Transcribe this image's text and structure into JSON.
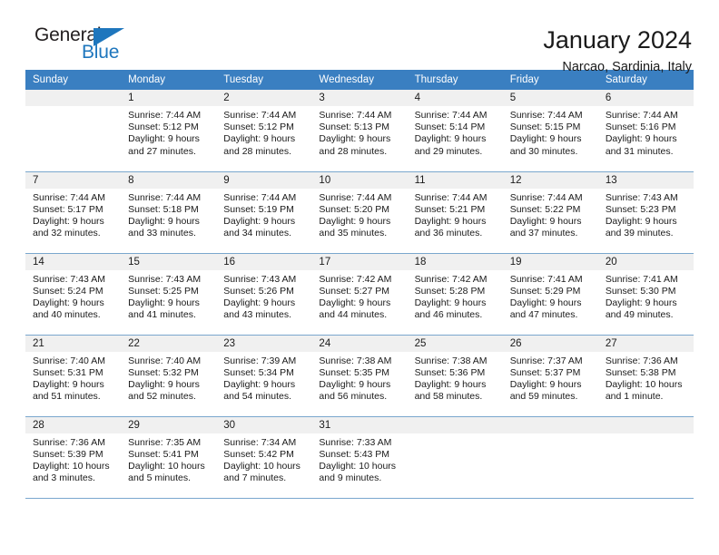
{
  "brand": {
    "name_top": "General",
    "name_bottom": "Blue",
    "accent_color": "#1e76bd"
  },
  "header": {
    "title": "January 2024",
    "subtitle": "Narcao, Sardinia, Italy"
  },
  "colors": {
    "header_bar": "#3a7fc1",
    "daynum_band": "#f0f0f0",
    "row_divider": "#7aa7ce",
    "text": "#1a1a1a"
  },
  "weekdays": [
    "Sunday",
    "Monday",
    "Tuesday",
    "Wednesday",
    "Thursday",
    "Friday",
    "Saturday"
  ],
  "weeks": [
    [
      {
        "day": "",
        "sunrise": "",
        "sunset": "",
        "daylight_line1": "",
        "daylight_line2": ""
      },
      {
        "day": "1",
        "sunrise": "Sunrise: 7:44 AM",
        "sunset": "Sunset: 5:12 PM",
        "daylight_line1": "Daylight: 9 hours",
        "daylight_line2": "and 27 minutes."
      },
      {
        "day": "2",
        "sunrise": "Sunrise: 7:44 AM",
        "sunset": "Sunset: 5:12 PM",
        "daylight_line1": "Daylight: 9 hours",
        "daylight_line2": "and 28 minutes."
      },
      {
        "day": "3",
        "sunrise": "Sunrise: 7:44 AM",
        "sunset": "Sunset: 5:13 PM",
        "daylight_line1": "Daylight: 9 hours",
        "daylight_line2": "and 28 minutes."
      },
      {
        "day": "4",
        "sunrise": "Sunrise: 7:44 AM",
        "sunset": "Sunset: 5:14 PM",
        "daylight_line1": "Daylight: 9 hours",
        "daylight_line2": "and 29 minutes."
      },
      {
        "day": "5",
        "sunrise": "Sunrise: 7:44 AM",
        "sunset": "Sunset: 5:15 PM",
        "daylight_line1": "Daylight: 9 hours",
        "daylight_line2": "and 30 minutes."
      },
      {
        "day": "6",
        "sunrise": "Sunrise: 7:44 AM",
        "sunset": "Sunset: 5:16 PM",
        "daylight_line1": "Daylight: 9 hours",
        "daylight_line2": "and 31 minutes."
      }
    ],
    [
      {
        "day": "7",
        "sunrise": "Sunrise: 7:44 AM",
        "sunset": "Sunset: 5:17 PM",
        "daylight_line1": "Daylight: 9 hours",
        "daylight_line2": "and 32 minutes."
      },
      {
        "day": "8",
        "sunrise": "Sunrise: 7:44 AM",
        "sunset": "Sunset: 5:18 PM",
        "daylight_line1": "Daylight: 9 hours",
        "daylight_line2": "and 33 minutes."
      },
      {
        "day": "9",
        "sunrise": "Sunrise: 7:44 AM",
        "sunset": "Sunset: 5:19 PM",
        "daylight_line1": "Daylight: 9 hours",
        "daylight_line2": "and 34 minutes."
      },
      {
        "day": "10",
        "sunrise": "Sunrise: 7:44 AM",
        "sunset": "Sunset: 5:20 PM",
        "daylight_line1": "Daylight: 9 hours",
        "daylight_line2": "and 35 minutes."
      },
      {
        "day": "11",
        "sunrise": "Sunrise: 7:44 AM",
        "sunset": "Sunset: 5:21 PM",
        "daylight_line1": "Daylight: 9 hours",
        "daylight_line2": "and 36 minutes."
      },
      {
        "day": "12",
        "sunrise": "Sunrise: 7:44 AM",
        "sunset": "Sunset: 5:22 PM",
        "daylight_line1": "Daylight: 9 hours",
        "daylight_line2": "and 37 minutes."
      },
      {
        "day": "13",
        "sunrise": "Sunrise: 7:43 AM",
        "sunset": "Sunset: 5:23 PM",
        "daylight_line1": "Daylight: 9 hours",
        "daylight_line2": "and 39 minutes."
      }
    ],
    [
      {
        "day": "14",
        "sunrise": "Sunrise: 7:43 AM",
        "sunset": "Sunset: 5:24 PM",
        "daylight_line1": "Daylight: 9 hours",
        "daylight_line2": "and 40 minutes."
      },
      {
        "day": "15",
        "sunrise": "Sunrise: 7:43 AM",
        "sunset": "Sunset: 5:25 PM",
        "daylight_line1": "Daylight: 9 hours",
        "daylight_line2": "and 41 minutes."
      },
      {
        "day": "16",
        "sunrise": "Sunrise: 7:43 AM",
        "sunset": "Sunset: 5:26 PM",
        "daylight_line1": "Daylight: 9 hours",
        "daylight_line2": "and 43 minutes."
      },
      {
        "day": "17",
        "sunrise": "Sunrise: 7:42 AM",
        "sunset": "Sunset: 5:27 PM",
        "daylight_line1": "Daylight: 9 hours",
        "daylight_line2": "and 44 minutes."
      },
      {
        "day": "18",
        "sunrise": "Sunrise: 7:42 AM",
        "sunset": "Sunset: 5:28 PM",
        "daylight_line1": "Daylight: 9 hours",
        "daylight_line2": "and 46 minutes."
      },
      {
        "day": "19",
        "sunrise": "Sunrise: 7:41 AM",
        "sunset": "Sunset: 5:29 PM",
        "daylight_line1": "Daylight: 9 hours",
        "daylight_line2": "and 47 minutes."
      },
      {
        "day": "20",
        "sunrise": "Sunrise: 7:41 AM",
        "sunset": "Sunset: 5:30 PM",
        "daylight_line1": "Daylight: 9 hours",
        "daylight_line2": "and 49 minutes."
      }
    ],
    [
      {
        "day": "21",
        "sunrise": "Sunrise: 7:40 AM",
        "sunset": "Sunset: 5:31 PM",
        "daylight_line1": "Daylight: 9 hours",
        "daylight_line2": "and 51 minutes."
      },
      {
        "day": "22",
        "sunrise": "Sunrise: 7:40 AM",
        "sunset": "Sunset: 5:32 PM",
        "daylight_line1": "Daylight: 9 hours",
        "daylight_line2": "and 52 minutes."
      },
      {
        "day": "23",
        "sunrise": "Sunrise: 7:39 AM",
        "sunset": "Sunset: 5:34 PM",
        "daylight_line1": "Daylight: 9 hours",
        "daylight_line2": "and 54 minutes."
      },
      {
        "day": "24",
        "sunrise": "Sunrise: 7:38 AM",
        "sunset": "Sunset: 5:35 PM",
        "daylight_line1": "Daylight: 9 hours",
        "daylight_line2": "and 56 minutes."
      },
      {
        "day": "25",
        "sunrise": "Sunrise: 7:38 AM",
        "sunset": "Sunset: 5:36 PM",
        "daylight_line1": "Daylight: 9 hours",
        "daylight_line2": "and 58 minutes."
      },
      {
        "day": "26",
        "sunrise": "Sunrise: 7:37 AM",
        "sunset": "Sunset: 5:37 PM",
        "daylight_line1": "Daylight: 9 hours",
        "daylight_line2": "and 59 minutes."
      },
      {
        "day": "27",
        "sunrise": "Sunrise: 7:36 AM",
        "sunset": "Sunset: 5:38 PM",
        "daylight_line1": "Daylight: 10 hours",
        "daylight_line2": "and 1 minute."
      }
    ],
    [
      {
        "day": "28",
        "sunrise": "Sunrise: 7:36 AM",
        "sunset": "Sunset: 5:39 PM",
        "daylight_line1": "Daylight: 10 hours",
        "daylight_line2": "and 3 minutes."
      },
      {
        "day": "29",
        "sunrise": "Sunrise: 7:35 AM",
        "sunset": "Sunset: 5:41 PM",
        "daylight_line1": "Daylight: 10 hours",
        "daylight_line2": "and 5 minutes."
      },
      {
        "day": "30",
        "sunrise": "Sunrise: 7:34 AM",
        "sunset": "Sunset: 5:42 PM",
        "daylight_line1": "Daylight: 10 hours",
        "daylight_line2": "and 7 minutes."
      },
      {
        "day": "31",
        "sunrise": "Sunrise: 7:33 AM",
        "sunset": "Sunset: 5:43 PM",
        "daylight_line1": "Daylight: 10 hours",
        "daylight_line2": "and 9 minutes."
      },
      {
        "day": "",
        "sunrise": "",
        "sunset": "",
        "daylight_line1": "",
        "daylight_line2": ""
      },
      {
        "day": "",
        "sunrise": "",
        "sunset": "",
        "daylight_line1": "",
        "daylight_line2": ""
      },
      {
        "day": "",
        "sunrise": "",
        "sunset": "",
        "daylight_line1": "",
        "daylight_line2": ""
      }
    ]
  ]
}
